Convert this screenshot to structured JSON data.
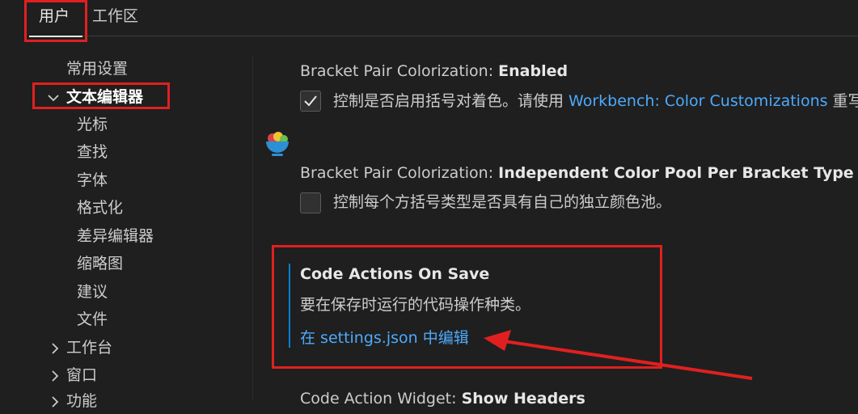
{
  "tabs": {
    "user": "用户",
    "workspace": "工作区"
  },
  "sidebar": {
    "items": [
      {
        "label": "常用设置"
      },
      {
        "label": "文本编辑器"
      },
      {
        "label": "光标"
      },
      {
        "label": "查找"
      },
      {
        "label": "字体"
      },
      {
        "label": "格式化"
      },
      {
        "label": "差异编辑器"
      },
      {
        "label": "缩略图"
      },
      {
        "label": "建议"
      },
      {
        "label": "文件"
      },
      {
        "label": "工作台"
      },
      {
        "label": "窗口"
      },
      {
        "label": "功能"
      }
    ]
  },
  "settings": {
    "bracket_colorization": {
      "title_prefix": "Bracket Pair Colorization: ",
      "title_name": "Enabled",
      "desc_prefix": "控制是否启用括号对着色。请使用 ",
      "desc_link": "Workbench: Color Customizations",
      "desc_suffix": " 重写",
      "checked": true
    },
    "independent_pool": {
      "title_prefix": "Bracket Pair Colorization: ",
      "title_name": "Independent Color Pool Per Bracket Type",
      "desc": "控制每个方括号类型是否具有自己的独立颜色池。",
      "checked": false
    },
    "code_actions": {
      "title": "Code Actions On Save",
      "desc": "要在保存时运行的代码操作种类。",
      "link": "在 settings.json 中编辑"
    },
    "next": {
      "title_prefix": "Code Action Widget: ",
      "title_name": "Show Headers"
    }
  },
  "colors": {
    "background": "#1f1f1f",
    "text": "#cccccc",
    "link": "#4daafc",
    "focus_bar": "#007fd4",
    "annotation_red": "#e02020"
  }
}
